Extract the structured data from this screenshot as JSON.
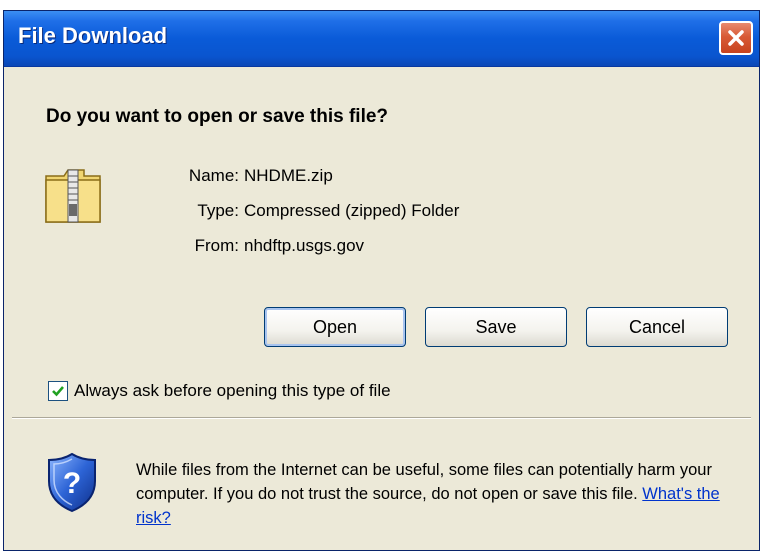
{
  "window": {
    "title": "File Download",
    "close_label": "✕"
  },
  "dialog": {
    "question": "Do you want to open or save this file?",
    "file_icon": "zip-folder-icon",
    "fields": [
      {
        "label": "Name:",
        "value": "NHDME.zip"
      },
      {
        "label": "Type:",
        "value": "Compressed (zipped) Folder"
      },
      {
        "label": "From:",
        "value": "nhdftp.usgs.gov"
      }
    ],
    "buttons": {
      "open": "Open",
      "save": "Save",
      "cancel": "Cancel"
    },
    "always_ask": {
      "label": "Always ask before opening this type of file",
      "checked": true
    },
    "warning": {
      "icon": "shield-question-icon",
      "text": "While files from the Internet can be useful, some files can potentially harm your computer. If you do not trust the source, do not open or save this file.",
      "link": "What's the risk?"
    }
  },
  "colors": {
    "titlebar": "#0a5bd8",
    "dialog_bg": "#ece9d8",
    "close_button": "#d85a36",
    "link": "#0033cc"
  }
}
